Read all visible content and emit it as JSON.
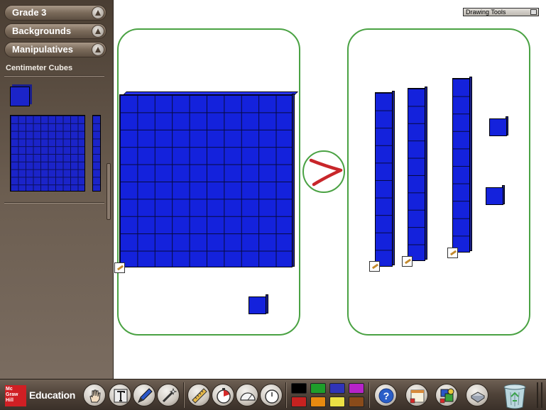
{
  "sidebar": {
    "menus": [
      {
        "label": "Grade 3"
      },
      {
        "label": "Backgrounds"
      },
      {
        "label": "Manipulatives"
      }
    ],
    "category_label": "Centimeter Cubes",
    "palette_items": [
      "unit-cube",
      "flat-of-100",
      "rod-of-10"
    ]
  },
  "drawing_tools": {
    "label": "Drawing Tools"
  },
  "workspace": {
    "left_group": {
      "flats": 1,
      "rods": 0,
      "units": 1
    },
    "right_group": {
      "flats": 0,
      "rods": 3,
      "units": 2
    },
    "comparison_symbol": ">",
    "symbol_color": "#c8262a",
    "frame_color": "#4aa243",
    "block_color": "#1422dc"
  },
  "toolbar": {
    "logo_lines": [
      "Mc",
      "Graw",
      "Hill"
    ],
    "logo_word": "Education",
    "tools": [
      "hand-icon",
      "text-icon",
      "pen-icon",
      "wand-icon",
      "ruler-icon",
      "timer-icon",
      "protractor-icon",
      "stopwatch-icon"
    ],
    "colors": [
      "#000000",
      "#1e9e2a",
      "#3034b8",
      "#b623c9",
      "#c72220",
      "#e88a10",
      "#ece044",
      "#8a4b1a"
    ],
    "actions": [
      "help-icon",
      "calendar-icon",
      "shapes-icon",
      "print-icon",
      "trash-icon"
    ]
  }
}
